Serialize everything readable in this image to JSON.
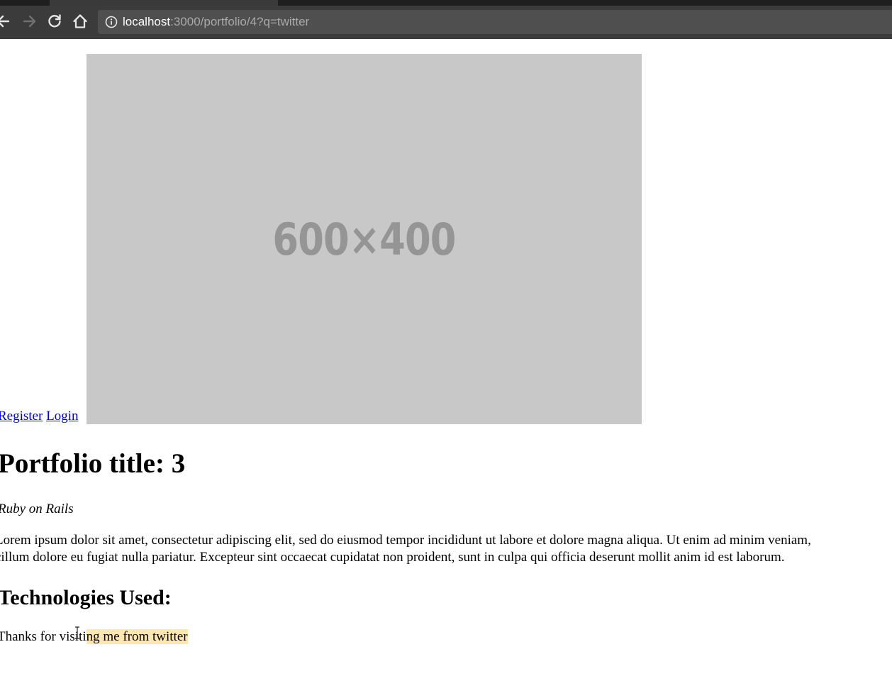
{
  "browser": {
    "url_host": "localhost",
    "url_path": ":3000/portfolio/4?q=twitter",
    "icons": {
      "back": "arrow-left-icon",
      "forward": "arrow-right-icon",
      "reload": "reload-icon",
      "home": "home-icon",
      "info": "info-icon"
    }
  },
  "nav": {
    "register_label": "Register",
    "login_label": "Login"
  },
  "portfolio": {
    "image_label": "600×400",
    "title": "Portfolio title: 3",
    "subtitle": "Ruby on Rails",
    "body_line_1": "Lorem ipsum dolor sit amet, consectetur adipiscing elit, sed do eiusmod tempor incididunt ut labore et dolore magna aliqua. Ut enim ad minim veniam,",
    "body_line_2": "cillum dolore eu fugiat nulla pariatur. Excepteur sint occaecat cupidatat non proident, sunt in culpa qui officia deserunt mollit anim id est laborum.",
    "technologies_heading": "Technologies Used:",
    "source_prefix": "Thanks for visiti",
    "source_highlight": "ng me from twitter"
  },
  "colors": {
    "chrome_bg": "#3b3b3b",
    "omnibox_bg": "#4f4f4f",
    "link": "#0000ee",
    "placeholder_bg": "#c8c8c8",
    "placeholder_text": "#959595",
    "highlight": "#ffe8b0"
  }
}
